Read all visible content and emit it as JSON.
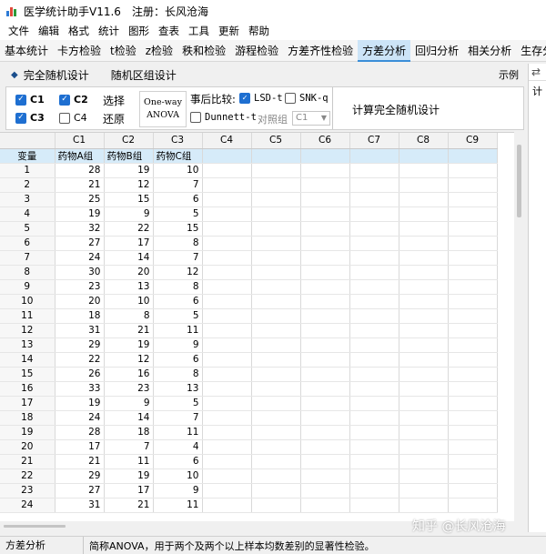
{
  "window": {
    "title": "医学统计助手V11.6",
    "registration": "注册：长风沧海"
  },
  "menu": [
    "文件",
    "编辑",
    "格式",
    "统计",
    "图形",
    "查表",
    "工具",
    "更新",
    "帮助"
  ],
  "tabs": [
    {
      "label": "基本统计",
      "active": false
    },
    {
      "label": "卡方检验",
      "active": false
    },
    {
      "label": "t检验",
      "active": false
    },
    {
      "label": "z检验",
      "active": false
    },
    {
      "label": "秩和检验",
      "active": false
    },
    {
      "label": "游程检验",
      "active": false
    },
    {
      "label": "方差齐性检验",
      "active": false
    },
    {
      "label": "方差分析",
      "active": true
    },
    {
      "label": "回归分析",
      "active": false
    },
    {
      "label": "相关分析",
      "active": false
    },
    {
      "label": "生存分析",
      "active": false
    }
  ],
  "subtabs": {
    "completely_random": "完全随机设计",
    "random_block": "随机区组设计",
    "example": "示例"
  },
  "options": {
    "c1": "C1",
    "c2": "C2",
    "c3": "C3",
    "c4": "C4",
    "select": "选择",
    "restore": "还原",
    "anova_line1": "One-way",
    "anova_line2": "ANOVA",
    "posthoc_label": "事后比较:",
    "lsd": "LSD-t",
    "snk": "SNK-q",
    "dunnett": "Dunnett-t",
    "control_label": "对照组",
    "control_value": "C1",
    "compute_button": "计算完全随机设计"
  },
  "grid": {
    "columns": [
      "C1",
      "C2",
      "C3",
      "C4",
      "C5",
      "C6",
      "C7",
      "C8",
      "C9"
    ],
    "var_label": "变量",
    "names": [
      "药物A组",
      "药物B组",
      "药物C组"
    ],
    "rows": [
      [
        28,
        19,
        10
      ],
      [
        21,
        12,
        7
      ],
      [
        25,
        15,
        6
      ],
      [
        19,
        9,
        5
      ],
      [
        32,
        22,
        15
      ],
      [
        27,
        17,
        8
      ],
      [
        24,
        14,
        7
      ],
      [
        30,
        20,
        12
      ],
      [
        23,
        13,
        8
      ],
      [
        20,
        10,
        6
      ],
      [
        18,
        8,
        5
      ],
      [
        31,
        21,
        11
      ],
      [
        29,
        19,
        9
      ],
      [
        22,
        12,
        6
      ],
      [
        26,
        16,
        8
      ],
      [
        33,
        23,
        13
      ],
      [
        19,
        9,
        5
      ],
      [
        24,
        14,
        7
      ],
      [
        28,
        18,
        11
      ],
      [
        17,
        7,
        4
      ],
      [
        21,
        11,
        6
      ],
      [
        29,
        19,
        10
      ],
      [
        27,
        17,
        9
      ],
      [
        31,
        21,
        11
      ]
    ]
  },
  "right_pane": {
    "label": "计"
  },
  "status": {
    "left": "方差分析",
    "message": "简称ANOVA，用于两个及两个以上样本均数差别的显著性检验。"
  },
  "watermark": "知乎 @长风沧海",
  "colors": {
    "accent": "#1e6fd1",
    "active_tab": "#cce4f7",
    "name_row": "#d6ebf9"
  }
}
